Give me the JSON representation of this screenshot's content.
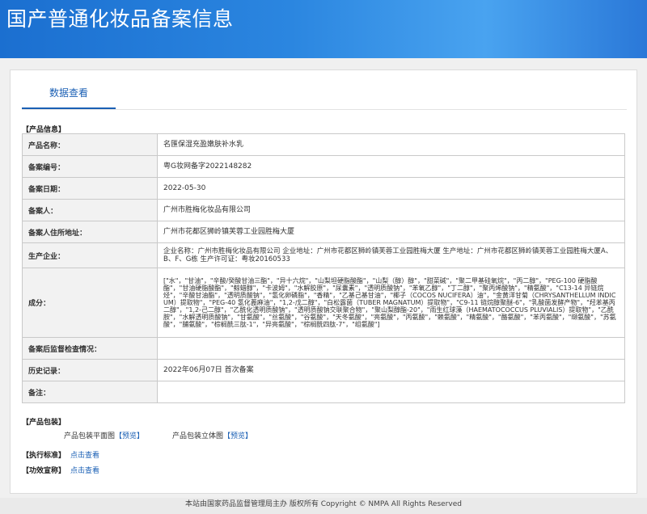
{
  "header": {
    "title": "国产普通化妆品备案信息"
  },
  "tab": {
    "label": "数据查看"
  },
  "product_section_title": "【产品信息】",
  "fields": [
    {
      "key": "产品名称：",
      "value": "名匯保湿充盈嫩肤补水乳"
    },
    {
      "key": "备案编号：",
      "value": "粤G妆网备字2022148282"
    },
    {
      "key": "备案日期：",
      "value": "2022-05-30"
    },
    {
      "key": "备案人：",
      "value": "广州市胜梅化妆品有限公司"
    },
    {
      "key": "备案人住所地址：",
      "value": "广州市花都区狮岭镇芙蓉工业园胜梅大厦"
    },
    {
      "key": "生产企业：",
      "value": "企业名称：广州市胜梅化妆品有限公司 企业地址：广州市花都区狮岭镇芙蓉工业园胜梅大厦 生产地址：广州市花都区狮岭镇芙蓉工业园胜梅大厦A、B、F、G栋 生产许可证：粤妆20160533"
    },
    {
      "key": "成分：",
      "value": "[\"水\"，\"甘油\"，\"辛酸/癸酸甘油三酯\"，\"异十六烷\"，\"山梨坦硬脂酸酯\"，\"山梨（醇）醇\"，\"甜菜碱\"，\"聚二甲基硅氧烷\"，\"丙二醇\"，\"PEG-100 硬脂酸酯\"，\"甘油硬脂酸酯\"，\"鲸蜡醇\"，\"卡波姆\"，\"水解胶原\"，\"尿囊素\"，\"透明质酸钠\"，\"苯氧乙醇\"，\"丁二醇\"，\"聚丙烯酸钠\"，\"精氨酸\"，\"C13-14 异链烷烃\"，\"辛酸甘油酯\"，\"透明质酸钠\"，\"氢化卵磷脂\"，\"香精\"，\"乙基己基甘油\"，\"椰子（COCOS NUCIFERA）油\"，\"金黄洋甘菊（CHRYSANTHELLUM INDICUM）提取物\"，\"PEG-40 氢化蓖麻油\"，\"1,2-戊二醇\"，\"白松露菌（TUBER MAGNATUM）提取物\"，\"C9-11 链烷醇聚醚-6\"，\"乳酸菌发酵产物\"，\"羟苯基丙二醇\"，\"1,2-己二醇\"，\"乙酰化透明质酸钠\"，\"透明质酸钠交联聚合物\"，\"聚山梨醇酯-20\"，\"雨生红球藻（HAEMATOCOCCUS PLUVIALIS）提取物\"，\"乙酰胺\"，\"水解透明质酸钠\"，\"甘氨酸\"，\"丝氨酸\"，\"谷氨酸\"，\"天冬氨酸\"，\"亮氨酸\"，\"丙氨酸\"，\"赖氨酸\"，\"精氨酸\"，\"酪氨酸\"，\"苯丙氨酸\"，\"缬氨酸\"，\"苏氨酸\"，\"脯氨酸\"，\"棕榈酰三肽-1\"，\"异亮氨酸\"，\"棕榈酰四肽-7\"，\"组氨酸\"]"
    },
    {
      "key": "备案后监督检查情况：",
      "value": ""
    },
    {
      "key": "历史记录：",
      "value": "2022年06月07日 首次备案"
    },
    {
      "key": "备注：",
      "value": ""
    }
  ],
  "package_section_title": "【产品包装】",
  "package": {
    "flat_label": "产品包装平面图",
    "flat_link": "【预览】",
    "solid_label": "产品包装立体图",
    "solid_link": "【预览】"
  },
  "standard": {
    "label": "【执行标准】",
    "link": "点击查看"
  },
  "efficacy": {
    "label": "【功效宣称】",
    "link": "点击查看"
  },
  "footer": {
    "text": "本站由国家药品监督管理局主办 版权所有 Copyright © NMPA All Rights Reserved"
  },
  "colors": {
    "header_blue": "#1b6fd0",
    "link_blue": "#1a5fb4"
  }
}
